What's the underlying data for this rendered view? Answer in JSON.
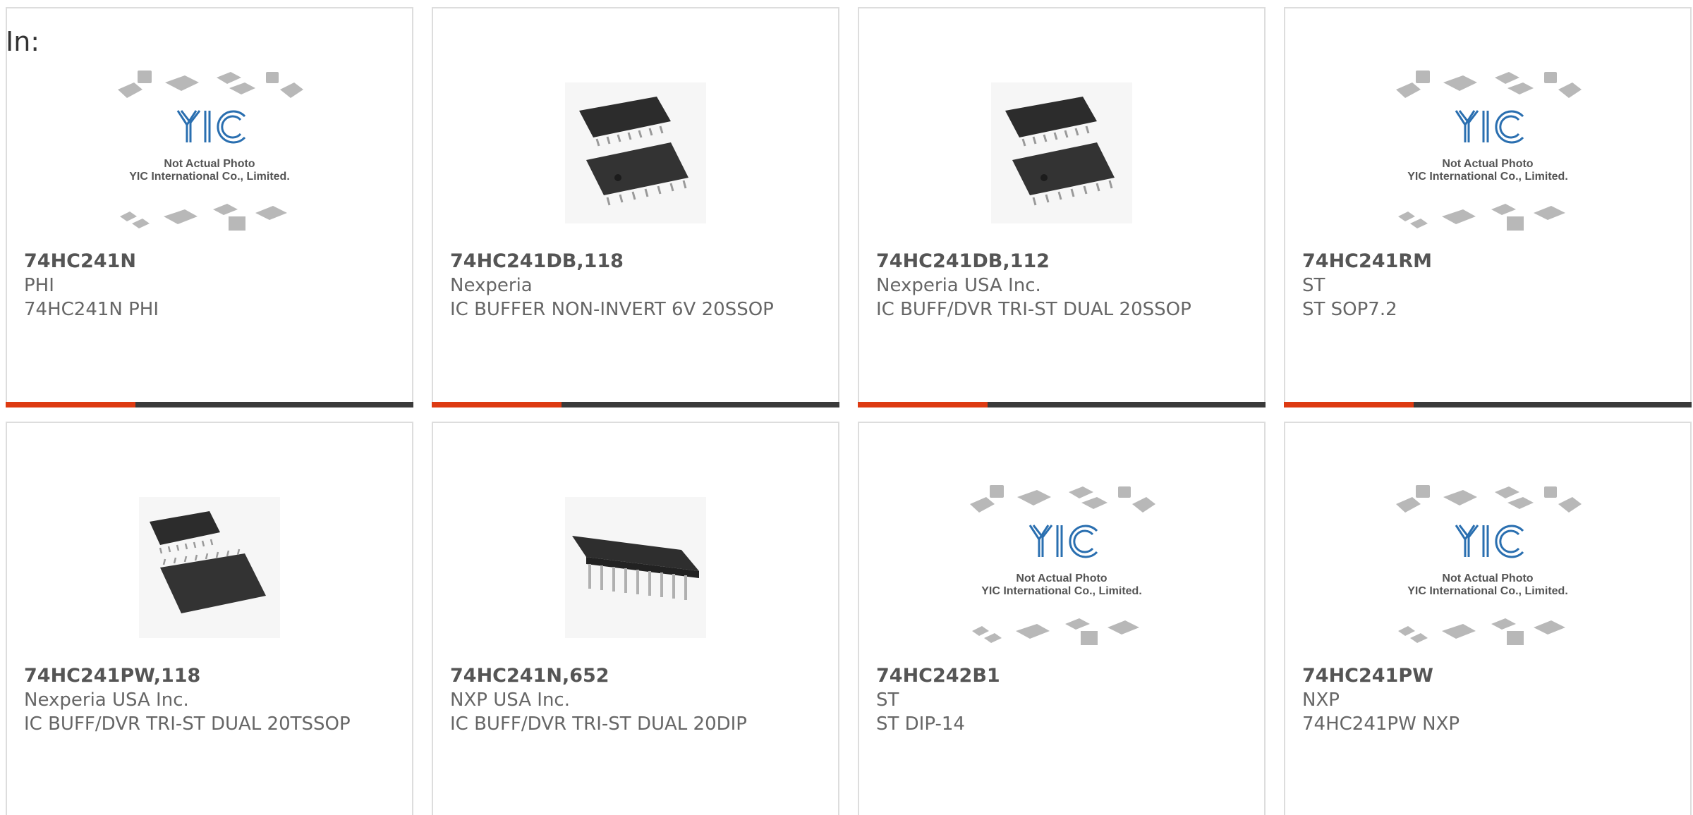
{
  "search": {
    "prefix": "In:"
  },
  "placeholder_image": {
    "brand": "YIC",
    "line1": "Not Actual Photo",
    "line2": "YIC International Co., Limited."
  },
  "accent_color": "#dd3a12",
  "bar_color": "#3a3a3a",
  "products": [
    {
      "part": "74HC241N",
      "manufacturer": "PHI",
      "description": "74HC241N PHI",
      "image": "placeholder"
    },
    {
      "part": "74HC241DB,118",
      "manufacturer": "Nexperia",
      "description": "IC BUFFER NON-INVERT 6V 20SSOP",
      "image": "ssop-chip"
    },
    {
      "part": "74HC241DB,112",
      "manufacturer": "Nexperia USA Inc.",
      "description": "IC BUFF/DVR TRI-ST DUAL 20SSOP",
      "image": "ssop-chip"
    },
    {
      "part": "74HC241RM",
      "manufacturer": "ST",
      "description": "ST SOP7.2",
      "image": "placeholder"
    },
    {
      "part": "74HC241PW,118",
      "manufacturer": "Nexperia USA Inc.",
      "description": "IC BUFF/DVR TRI-ST DUAL 20TSSOP",
      "image": "tssop-chip"
    },
    {
      "part": "74HC241N,652",
      "manufacturer": "NXP USA Inc.",
      "description": "IC BUFF/DVR TRI-ST DUAL 20DIP",
      "image": "dip-chip"
    },
    {
      "part": "74HC242B1",
      "manufacturer": "ST",
      "description": "ST DIP-14",
      "image": "placeholder"
    },
    {
      "part": "74HC241PW",
      "manufacturer": "NXP",
      "description": "74HC241PW NXP",
      "image": "placeholder"
    }
  ]
}
